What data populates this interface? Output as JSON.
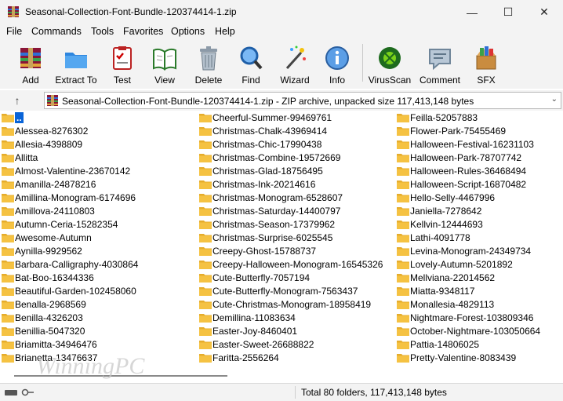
{
  "window": {
    "title": "Seasonal-Collection-Font-Bundle-120374414-1.zip",
    "minimize": "—",
    "maximize": "☐",
    "close": "✕"
  },
  "menu": [
    "File",
    "Commands",
    "Tools",
    "Favorites",
    "Options",
    "Help"
  ],
  "toolbar": [
    {
      "label": "Add",
      "icon": "add-icon"
    },
    {
      "label": "Extract To",
      "icon": "extract-icon"
    },
    {
      "label": "Test",
      "icon": "test-icon"
    },
    {
      "label": "View",
      "icon": "view-icon"
    },
    {
      "label": "Delete",
      "icon": "delete-icon"
    },
    {
      "label": "Find",
      "icon": "find-icon"
    },
    {
      "label": "Wizard",
      "icon": "wizard-icon"
    },
    {
      "label": "Info",
      "icon": "info-icon"
    },
    {
      "label": "VirusScan",
      "icon": "virusscan-icon"
    },
    {
      "label": "Comment",
      "icon": "comment-icon"
    },
    {
      "label": "SFX",
      "icon": "sfx-icon"
    }
  ],
  "address": {
    "up": "↑",
    "path": "Seasonal-Collection-Font-Bundle-120374414-1.zip - ZIP archive, unpacked size 117,413,148 bytes",
    "dropdown": "⌄"
  },
  "files": {
    "updir": "..",
    "columns": [
      [
        "Alessea-8276302",
        "Allesia-4398809",
        "Allitta",
        "Almost-Valentine-23670142",
        "Amanilla-24878216",
        "Amillina-Monogram-6174696",
        "Amillova-24110803",
        "Autumn-Ceria-15282354",
        "Awesome-Autumn",
        "Aynilla-9929562",
        "Barbara-Calligraphy-4030864",
        "Bat-Boo-16344336",
        "Beautiful-Garden-102458060",
        "Benalla-2968569",
        "Benilla-4326203",
        "Benillia-5047320",
        "Briamitta-34946476",
        "Brianetta-13476637"
      ],
      [
        "Cheerful-Summer-99469761",
        "Christmas-Chalk-43969414",
        "Christmas-Chic-17990438",
        "Christmas-Combine-19572669",
        "Christmas-Glad-18756495",
        "Christmas-Ink-20214616",
        "Christmas-Monogram-6528607",
        "Christmas-Saturday-14400797",
        "Christmas-Season-17379962",
        "Christmas-Surprise-6025545",
        "Creepy-Ghost-15788737",
        "Creepy-Halloween-Monogram-16545326",
        "Cute-Butterfly-7057194",
        "Cute-Butterfly-Monogram-7563437",
        "Cute-Christmas-Monogram-18958419",
        "Demillina-11083634",
        "Easter-Joy-8460401",
        "Easter-Sweet-26688822",
        "Faritta-2556264"
      ],
      [
        "Feilla-52057883",
        "Flower-Park-75455469",
        "Halloween-Festival-16231103",
        "Halloween-Park-78707742",
        "Halloween-Rules-36468494",
        "Halloween-Script-16870482",
        "Hello-Selly-4467996",
        "Janiella-7278642",
        "Kellvin-12444693",
        "Lathi-4091778",
        "Levina-Monogram-24349734",
        "Lovely-Autumn-5201892",
        "Mellviana-22014562",
        "Miatta-9348117",
        "Monallesia-4829113",
        "Nightmare-Forest-103809346",
        "October-Nightmare-103050664",
        "Pattia-14806025",
        "Pretty-Valentine-8083439"
      ]
    ]
  },
  "watermark": "WinningPC",
  "status": {
    "text": "Total 80 folders, 117,413,148 bytes"
  },
  "colors": {
    "folder": "#f5c242",
    "selection": "#0a64d8",
    "chrome": "#f3f3f3"
  }
}
